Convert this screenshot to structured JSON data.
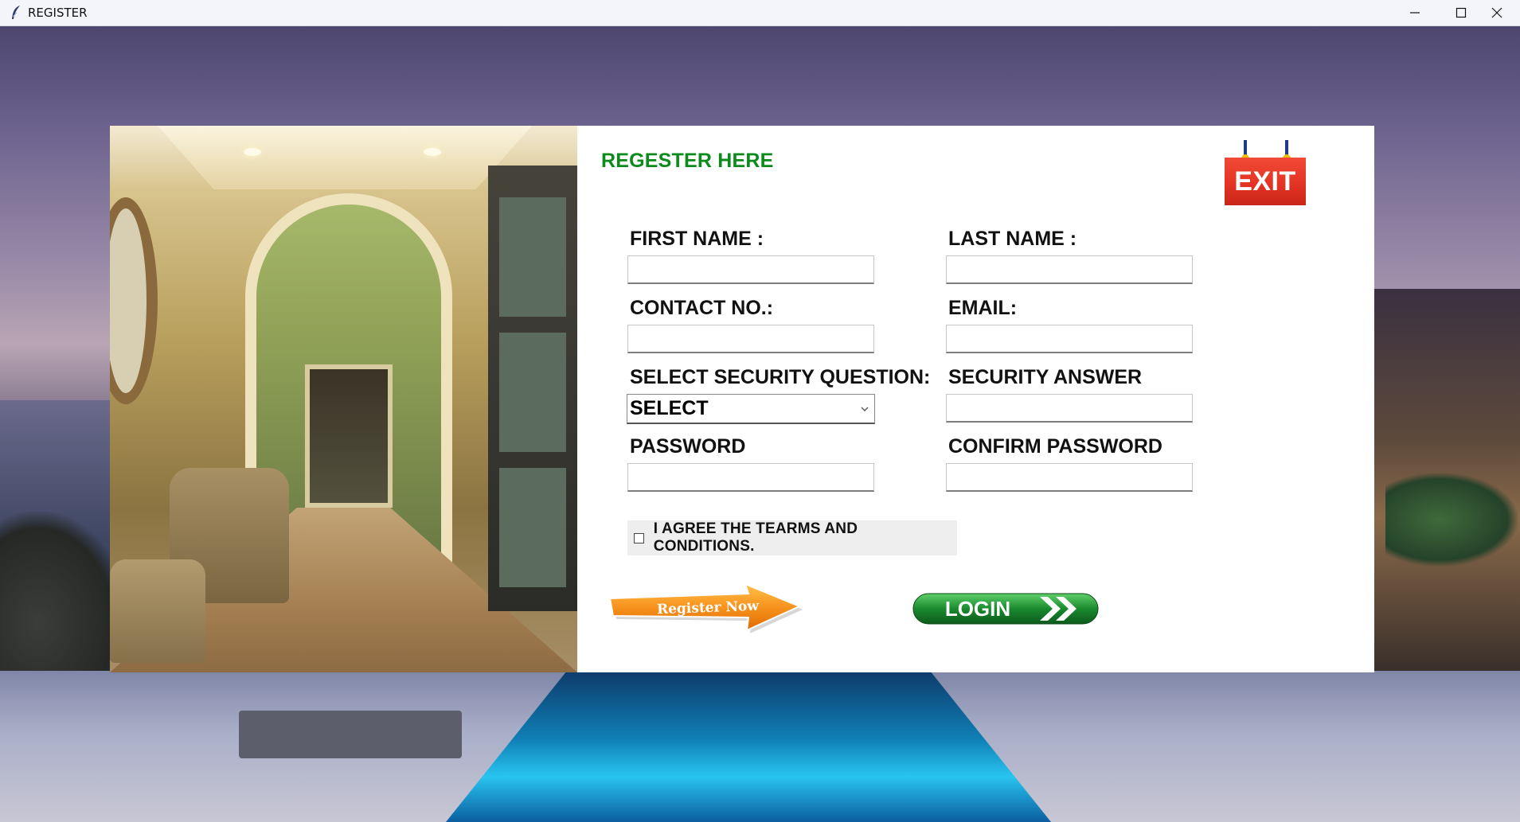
{
  "window": {
    "title": "REGISTER",
    "controls": [
      "minimize-icon",
      "maximize-icon",
      "close-icon"
    ]
  },
  "form": {
    "heading": "REGESTER HERE",
    "exit_label": "EXIT",
    "fields": {
      "first_name": {
        "label": "FIRST NAME :",
        "value": ""
      },
      "last_name": {
        "label": "LAST NAME :",
        "value": ""
      },
      "contact": {
        "label": "CONTACT NO.:",
        "value": ""
      },
      "email": {
        "label": "EMAIL:",
        "value": ""
      },
      "security_question": {
        "label": "SELECT SECURITY QUESTION:",
        "selected": "SELECT"
      },
      "security_answer": {
        "label": "SECURITY ANSWER",
        "value": ""
      },
      "password": {
        "label": "PASSWORD",
        "value": ""
      },
      "confirm_password": {
        "label": "CONFIRM PASSWORD",
        "value": ""
      }
    },
    "terms": {
      "label": "I AGREE THE TEARMS AND CONDITIONS.",
      "checked": false
    },
    "buttons": {
      "register": "Register Now",
      "login": "LOGIN"
    }
  },
  "colors": {
    "heading": "#0c8a1c",
    "exit_red": "#e43424",
    "register_orange": "#f7931e",
    "login_green": "#1a8a2e"
  }
}
